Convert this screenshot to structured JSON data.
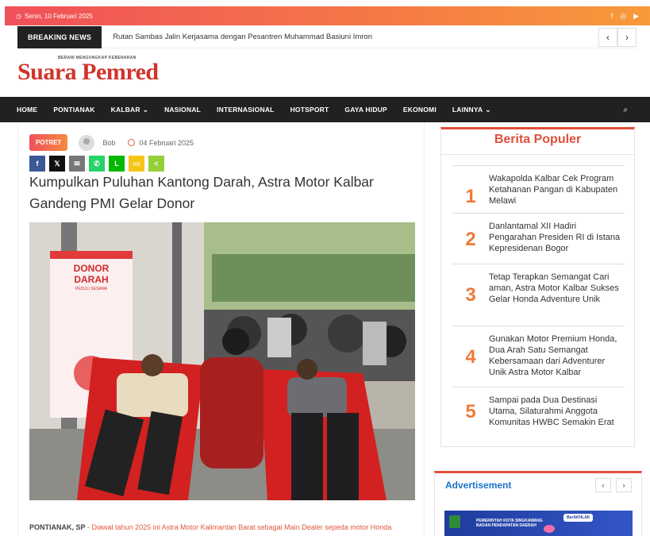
{
  "topbar": {
    "date": "Senin, 10 Februari 2025",
    "social_icons": [
      "facebook-icon",
      "instagram-icon",
      "youtube-icon"
    ]
  },
  "breaking": {
    "label": "BREAKING NEWS",
    "headline": "Rutan Sambas Jalin Kerjasama dengan Pesantren Muhammad Basiuni Imron"
  },
  "logo": {
    "tagline": "BERANI MENGUNGKAP KEBENARAN",
    "name": "Suara Pemred"
  },
  "nav": {
    "items": [
      "HOME",
      "PONTIANAK",
      "KALBAR",
      "NASIONAL",
      "INTERNASIONAL",
      "HOTSPORT",
      "GAYA HIDUP",
      "EKONOMI",
      "LAINNYA"
    ],
    "dropdowns": [
      "KALBAR",
      "LAINNYA"
    ]
  },
  "article": {
    "category": "POTRET",
    "author": "Bob",
    "date": "04 Februari 2025",
    "share": [
      {
        "name": "facebook",
        "glyph": "f",
        "color": "#3b5998"
      },
      {
        "name": "x",
        "glyph": "𝕏",
        "color": "#111111"
      },
      {
        "name": "email",
        "glyph": "✉",
        "color": "#777777"
      },
      {
        "name": "whatsapp",
        "glyph": "✆",
        "color": "#25d366"
      },
      {
        "name": "line",
        "glyph": "L",
        "color": "#00b900"
      },
      {
        "name": "sms",
        "glyph": "▭",
        "color": "#f5c518"
      },
      {
        "name": "sharethis",
        "glyph": "<",
        "color": "#95d03a"
      }
    ],
    "title": "Kumpulkan Puluhan Kantong Darah, Astra Motor Kalbar Gandeng PMI Gelar Donor",
    "photo_banner": {
      "line1": "DONOR",
      "line2": "DARAH",
      "line3": "PEDULI SESAMA"
    },
    "lead_location": "PONTIANAK, SP",
    "lead_text": "Diawal tahun 2025 ini Astra Motor Kalimantan Barat sebagai Main Dealer sepeda motor Honda"
  },
  "sidebar": {
    "title": "Berita Populer",
    "items": [
      {
        "num": "1",
        "title": "Wakapolda Kalbar Cek Program Ketahanan Pangan di Kabupaten Melawi"
      },
      {
        "num": "2",
        "title": "Danlantamal XII Hadiri Pengarahan Presiden RI di Istana Kepresidenan Bogor"
      },
      {
        "num": "3",
        "title": "Tetap Terapkan Semangat Cari aman, Astra Motor Kalbar Sukses Gelar Honda Adventure Unik"
      },
      {
        "num": "4",
        "title": "Gunakan Motor Premium Honda, Dua Arah Satu Semangat Kebersamaan dari Adventurer Unik Astra Motor Kalbar"
      },
      {
        "num": "5",
        "title": "Sampai pada Dua Destinasi Utama, Silaturahmi Anggota Komunitas HWBC Semakin Erat"
      }
    ]
  },
  "ad": {
    "title": "Advertisement",
    "banner_line1": "PEMERINTAH KOTA SINGKAWANG",
    "banner_line2": "BADAN PENDAPATAN DAERAH",
    "banner_tag": "BerAKHLAK"
  }
}
